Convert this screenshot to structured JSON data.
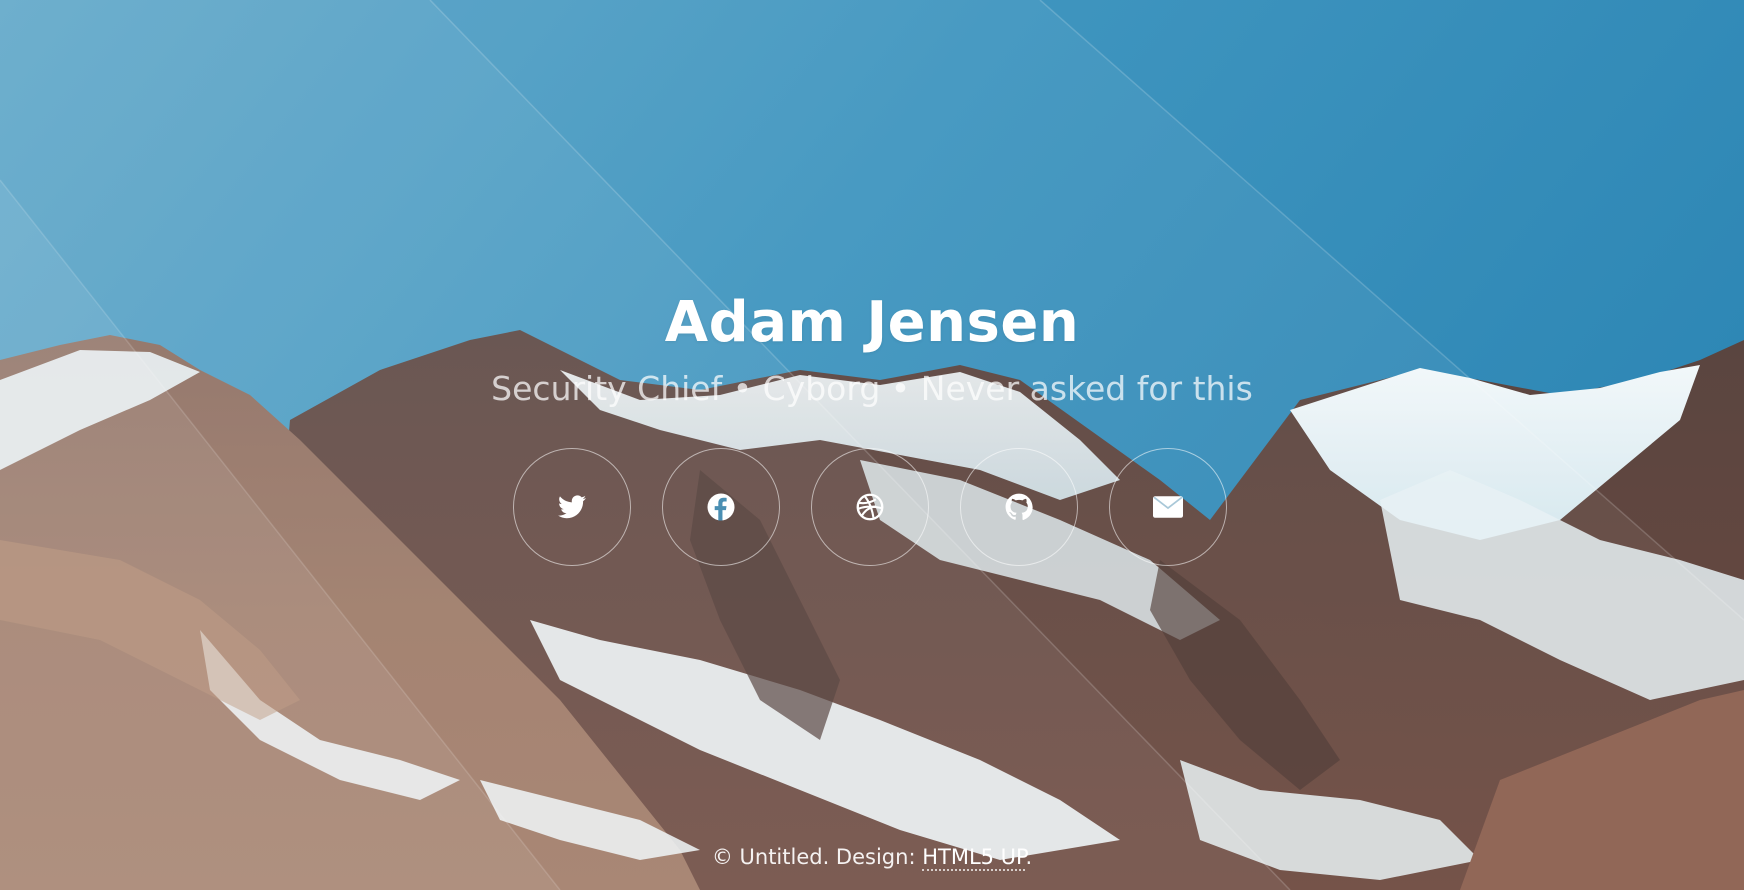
{
  "profile": {
    "name": "Adam Jensen",
    "tagline": "Security Chief • Cyborg • Never asked for this"
  },
  "social": [
    {
      "name": "twitter",
      "icon": "twitter-icon"
    },
    {
      "name": "facebook",
      "icon": "facebook-icon"
    },
    {
      "name": "dribbble",
      "icon": "dribbble-icon"
    },
    {
      "name": "github",
      "icon": "github-icon"
    },
    {
      "name": "email",
      "icon": "envelope-icon"
    }
  ],
  "footer": {
    "copyright": "© Untitled. Design: ",
    "link_label": "HTML5 UP",
    "trailing": "."
  },
  "colors": {
    "sky_top": "#2d88b6",
    "sky_light": "#5aa5c8",
    "rock": "#6b4a3f",
    "snow": "#e8f3f6"
  }
}
